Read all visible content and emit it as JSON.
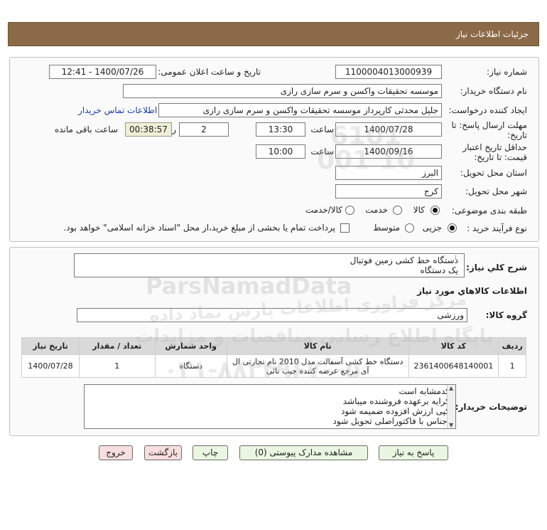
{
  "header": {
    "title": "جزئیات اطلاعات نیاز"
  },
  "form": {
    "need_number_label": "شماره نیاز:",
    "need_number": "1100004013000939",
    "announce_label": "تاریخ و ساعت اعلان عمومی:",
    "announce_value": "1400/07/26 - 12:41",
    "buyer_org_label": "نام دستگاه خریدار:",
    "buyer_org": "موسسه تحقیقات واکسن و سرم سازی رازی",
    "creator_label": "ایجاد کننده درخواست:",
    "creator": "جلیل محدثی کارپرداز موسسه تحقیقات واکسن و سرم سازی رازی",
    "contact_link": "اطلاعات تماس خریدار",
    "reply_deadline_label_1": "مهلت ارسال پاسخ: تا",
    "reply_deadline_label_2": "تاریخ:",
    "reply_date": "1400/07/28",
    "time_label": "ساعت",
    "reply_time": "13:30",
    "days_count": "2",
    "days_label": "روز و",
    "countdown": "00:38:57",
    "remaining_label": "ساعت باقی مانده",
    "validity_label_1": "حداقل تاریخ اعتبار",
    "validity_label_2": "قیمت: تا تاریخ:",
    "validity_date": "1400/09/16",
    "validity_time_label": "ساعت",
    "validity_time": "10:00",
    "province_label": "استان محل تحویل:",
    "province": "البرز",
    "city_label": "شهر محل تحویل:",
    "city": "کرج",
    "category_label": "طبقه بندی موضوعی:",
    "category_options": [
      "کالا",
      "خدمت",
      "کالا/خدمت"
    ],
    "category_selected": "کالا",
    "process_label": "نوع فرآیند خرید :",
    "process_options": [
      "جزیی",
      "متوسط"
    ],
    "process_selected": "جزیی",
    "payment_note": "پرداخت تمام یا بخشی از مبلغ خرید،از محل \"اسناد خزانه اسلامی\" خواهد بود."
  },
  "summary": {
    "label": "شرح کلي نياز:",
    "line1": "دستگاه خط کشی زمین فوتبال",
    "line2": "یک دستگاه"
  },
  "goods": {
    "section_title": "اطلاعات کالاهاي مورد نياز",
    "group_label": "گروه کالا:",
    "group_value": "ورزشی",
    "columns": [
      "ردیف",
      "کد کالا",
      "نام کالا",
      "واحد شمارش",
      "تعداد / مقدار",
      "تاریخ نیاز"
    ],
    "rows": [
      {
        "row": "1",
        "code": "2361400648140001",
        "name": "دستگاه خط کشی آسفالت مدل 2010 نام تجارتی ال آی مرجع عرضه کننده جیب تائی",
        "unit": "دستگاه",
        "qty": "1",
        "date": "1400/07/28"
      }
    ]
  },
  "buyer_notes": {
    "label": "توضیحات خریدار:",
    "lines": [
      "کدمشابه است",
      "کرایه برعهده فروشنده میباشد",
      "کپی ارزش افزوده ضمیمه شود",
      "اجناس با فاکتوراصلی تحویل شود"
    ]
  },
  "actions": {
    "reply": "پاسخ به نیاز",
    "attachments": "مشاهده مدارک پیوستی (0)",
    "print": "چاپ",
    "back": "بازگشت",
    "exit": "خروج"
  },
  "watermark": {
    "brand": "ParsNamadData",
    "line1": "مرکز فراوری اطلاعات پارس نماد داده",
    "line2": "پایگاه اطلاع رسانی مناقصات و مزایدات",
    "phone": "۰۲۱-۸۸۳۴۹۶۷۰-۵",
    "code": "6101 001 10"
  },
  "colors": {
    "header_bg": "#8b6a47",
    "button_green": "#eaf6e2",
    "button_red": "#f8dede",
    "link": "#1a3faa"
  }
}
